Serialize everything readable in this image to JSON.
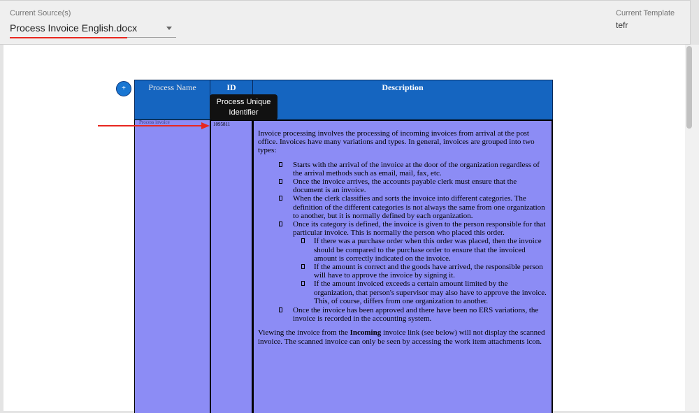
{
  "header": {
    "source_label": "Current Source(s)",
    "source_value": "Process Invoice English.docx",
    "template_label": "Current Template",
    "template_value": "tefr"
  },
  "table": {
    "add_button": "+",
    "headers": {
      "name": "Process Name",
      "id": "ID",
      "description": "Description"
    },
    "tooltip": "Process Unique Identifier",
    "row": {
      "name": "Process invoice",
      "id": "1095811",
      "intro": "Invoice processing involves the processing of incoming invoices from arrival at the post office. Invoices have many variations and types. In general, invoices are grouped into two types:",
      "bullets": [
        "Starts with the arrival of the invoice at the door of the organization regardless of the arrival methods such as email, mail, fax, etc.",
        "Once the invoice arrives, the accounts payable clerk must ensure that the document is an invoice.",
        "When the clerk classifies and sorts the invoice into different categories. The definition of the different categories is not always the same from one organization to another, but it is normally defined by each organization.",
        "Once its category is defined, the invoice is given to the person responsible for that particular invoice. This is normally the person who placed this order."
      ],
      "sub_bullets": [
        "If there was a purchase order when this order was placed, then the invoice should be compared to the purchase order to ensure that the invoiced amount is correctly indicated on the invoice.",
        "If the amount is correct and the goods have arrived, the responsible person will have to approve the invoice by signing it.",
        "If the amount invoiced exceeds a certain amount limited by the organization, that person's supervisor may also have to approve the invoice. This, of course, differs from one organization to another."
      ],
      "last_bullet": "Once the invoice has been approved and there have been no ERS variations, the invoice is recorded in the accounting system.",
      "closing_before": "Viewing the invoice from the ",
      "closing_bold": "Incoming",
      "closing_after": "  invoice link (see below) will not display the scanned invoice. The scanned invoice can only be seen by accessing   the work item attachments icon."
    }
  },
  "colors": {
    "header_blue": "#1565c0",
    "cell_purple": "#8c8cf5",
    "annotation_red": "#e8271f"
  }
}
